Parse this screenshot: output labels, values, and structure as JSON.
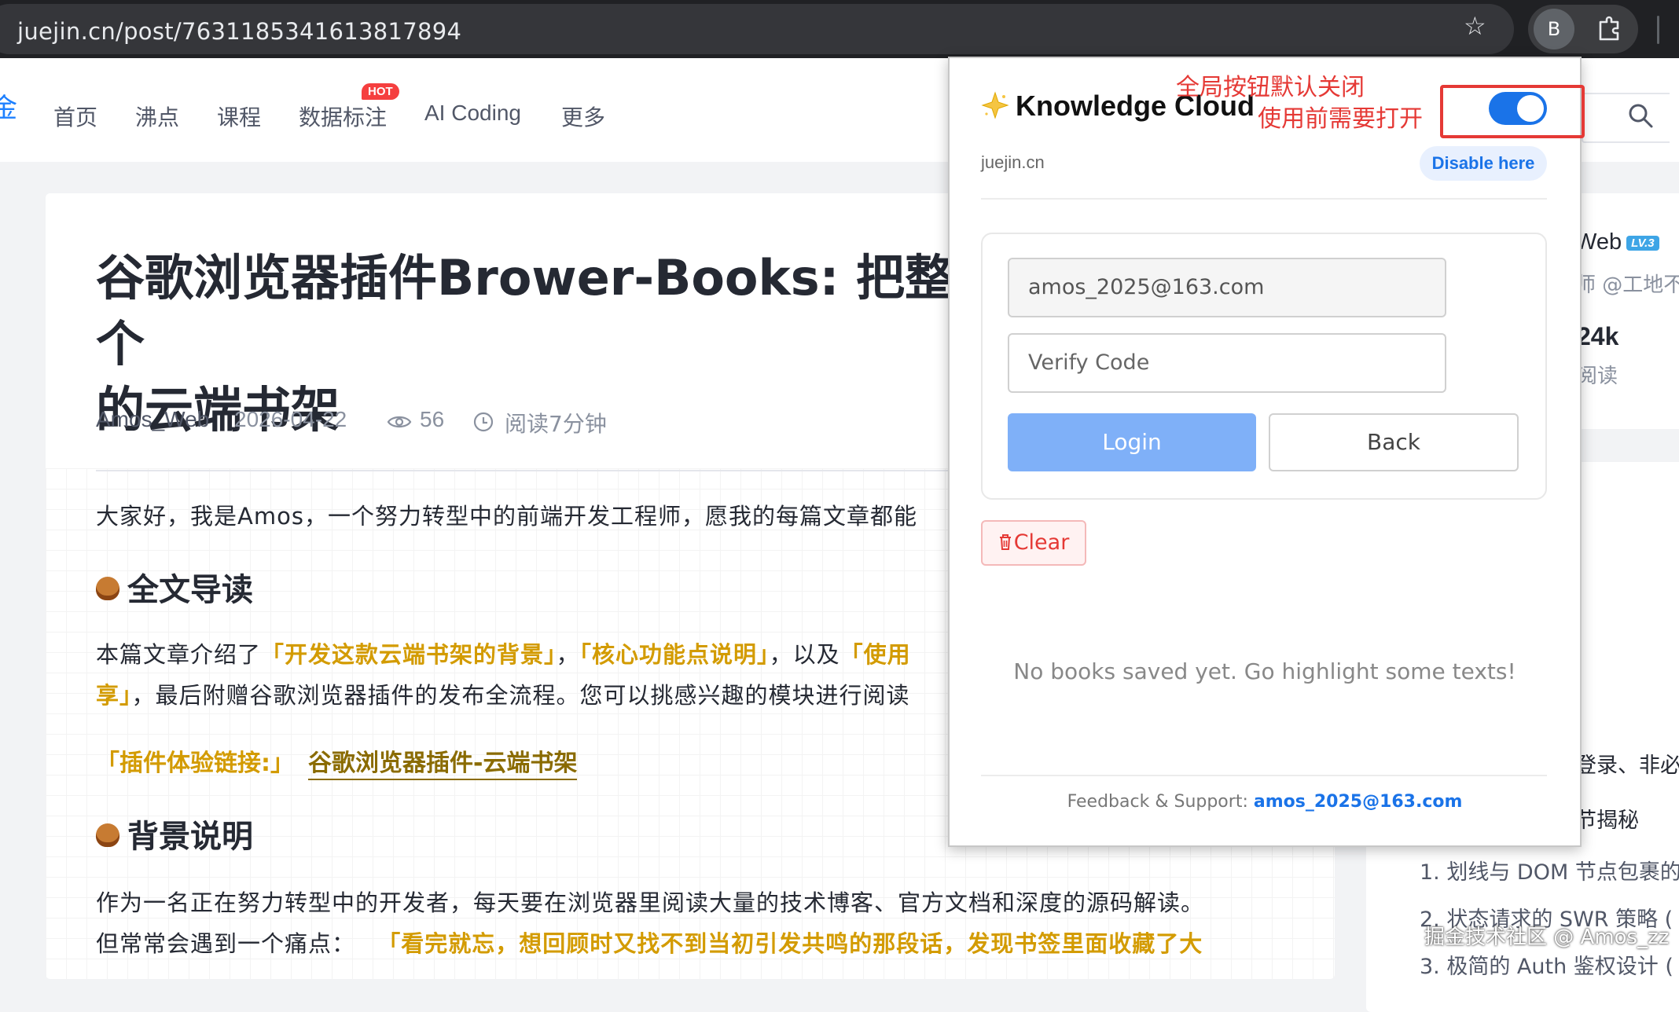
{
  "browser": {
    "url": "juejin.cn/post/7631185341613817894",
    "profile_initial": "B"
  },
  "site_nav": {
    "logo_fragment": "金",
    "items": [
      "首页",
      "沸点",
      "课程",
      "数据标注",
      "AI Coding",
      "更多"
    ],
    "hot_badge": "HOT"
  },
  "article": {
    "title_line1": "谷歌浏览器插件Brower-Books: 把整个",
    "title_line2": "的云端书架",
    "author": "Amos_Web",
    "date": "2026-04-22",
    "views": "56",
    "read_time": "阅读7分钟",
    "intro": "大家好，我是Amos，一个努力转型中的前端开发工程师，愿我的每篇文章都能",
    "h2_guide": "全文导读",
    "guide_p1_a": "本篇文章介绍了",
    "guide_p1_hl1": "「开发这款云端书架的背景」",
    "guide_p1_sep": "，",
    "guide_p1_hl2": "「核心功能点说明」",
    "guide_p1_b": "，以及",
    "guide_p1_hl3": "「使用",
    "guide_p2_hl": "享」",
    "guide_p2_b": "，最后附赠谷歌浏览器插件的发布全流程。您可以挑感兴趣的模块进行阅读",
    "link_label": "「插件体验链接:」",
    "link_text": "谷歌浏览器插件-云端书架",
    "h2_bg": "背景说明",
    "bg_p1": "作为一名正在努力转型中的开发者，每天要在浏览器里阅读大量的技术博客、官方文档和深度的源码解读。",
    "bg_p2_a": "但常常会遇到一个痛点：",
    "bg_p2_hl": "「看完就忘，想回顾时又找不到当初引发共鸣的那段话，发现书签里面收藏了大"
  },
  "sidebar": {
    "name_frag": "Web",
    "level": "LV.3",
    "role_frag": "师 @工地不",
    "stat_value": "24k",
    "stat_label": "阅读",
    "toc_frag1": "登录、非必",
    "toc_frag2": "节揭秘",
    "toc_item1": "1. 划线与 DOM 节点包裹的",
    "toc_item2": "2. 状态请求的 SWR 策略 (",
    "toc_item3": "3. 极简的 Auth 鉴权设计 (",
    "watermark": "掘金技术社区 @ Amos_zz"
  },
  "popup": {
    "title": "Knowledge Cloud",
    "annotation_line1": "全局按钮默认关闭",
    "annotation_line2": "使用前需要打开",
    "toggle_on": true,
    "domain": "juejin.cn",
    "disable_label": "Disable here",
    "email_value": "amos_2025@163.com",
    "code_placeholder": "Verify Code",
    "login_label": "Login",
    "back_label": "Back",
    "clear_label": "Clear",
    "empty_text": "No books saved yet. Go highlight some texts!",
    "footer_label": "Feedback & Support:",
    "footer_email": "amos_2025@163.com"
  }
}
